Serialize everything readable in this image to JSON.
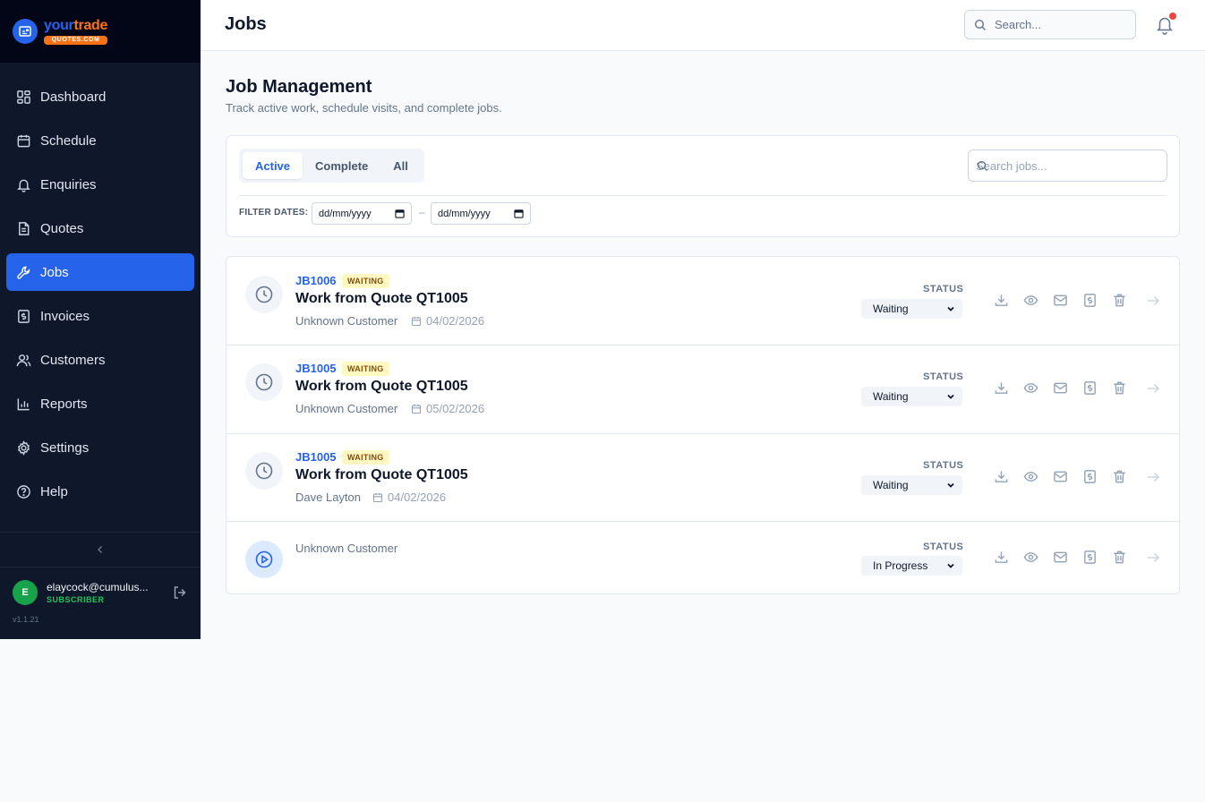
{
  "brand": {
    "name_a": "your",
    "name_b": "trade",
    "sub": "QUOTES.COM"
  },
  "sidebar": {
    "items": [
      {
        "label": "Dashboard",
        "icon": "dashboard-icon",
        "active": false
      },
      {
        "label": "Schedule",
        "icon": "calendar-icon",
        "active": false
      },
      {
        "label": "Enquiries",
        "icon": "bell-icon",
        "active": false
      },
      {
        "label": "Quotes",
        "icon": "document-icon",
        "active": false
      },
      {
        "label": "Jobs",
        "icon": "wrench-icon",
        "active": true
      },
      {
        "label": "Invoices",
        "icon": "invoice-icon",
        "active": false
      },
      {
        "label": "Customers",
        "icon": "users-icon",
        "active": false
      },
      {
        "label": "Reports",
        "icon": "bar-chart-icon",
        "active": false
      },
      {
        "label": "Settings",
        "icon": "gear-icon",
        "active": false
      },
      {
        "label": "Help",
        "icon": "help-icon",
        "active": false
      }
    ],
    "user": {
      "initial": "E",
      "email": "elaycock@cumulus...",
      "plan": "SUBSCRIBER"
    },
    "version": "v1.1.21"
  },
  "header": {
    "title": "Jobs",
    "search_placeholder": "Search..."
  },
  "main": {
    "title": "Job Management",
    "subtitle": "Track active work, schedule visits, and complete jobs.",
    "tabs": [
      {
        "label": "Active",
        "active": true
      },
      {
        "label": "Complete",
        "active": false
      },
      {
        "label": "All",
        "active": false
      }
    ],
    "job_search_placeholder": "Search jobs...",
    "filter_label": "FILTER DATES:",
    "date_from": "dd/mm/yyyy",
    "date_to": "dd/mm/yyyy",
    "date_separator": "–"
  },
  "jobs": [
    {
      "id": "JB1006",
      "badge": "WAITING",
      "title": "Work from Quote QT1005",
      "customer": "Unknown Customer",
      "date": "04/02/2026",
      "status_label": "STATUS",
      "status": "Waiting"
    },
    {
      "id": "JB1005",
      "badge": "WAITING",
      "title": "Work from Quote QT1005",
      "customer": "Unknown Customer",
      "date": "05/02/2026",
      "status_label": "STATUS",
      "status": "Waiting"
    },
    {
      "id": "JB1005",
      "badge": "WAITING",
      "title": "Work from Quote QT1005",
      "customer": "Dave Layton",
      "date": "04/02/2026",
      "status_label": "STATUS",
      "status": "Waiting"
    },
    {
      "id": "",
      "badge": "",
      "title": "",
      "customer": "Unknown Customer",
      "date": "",
      "status_label": "STATUS",
      "status": "In Progress"
    }
  ],
  "colors": {
    "primary": "#2563eb",
    "sidebar_bg": "#0f172a",
    "brand_orange": "#f97316",
    "badge_bg": "#fef9c3",
    "badge_text": "#854d0e"
  }
}
